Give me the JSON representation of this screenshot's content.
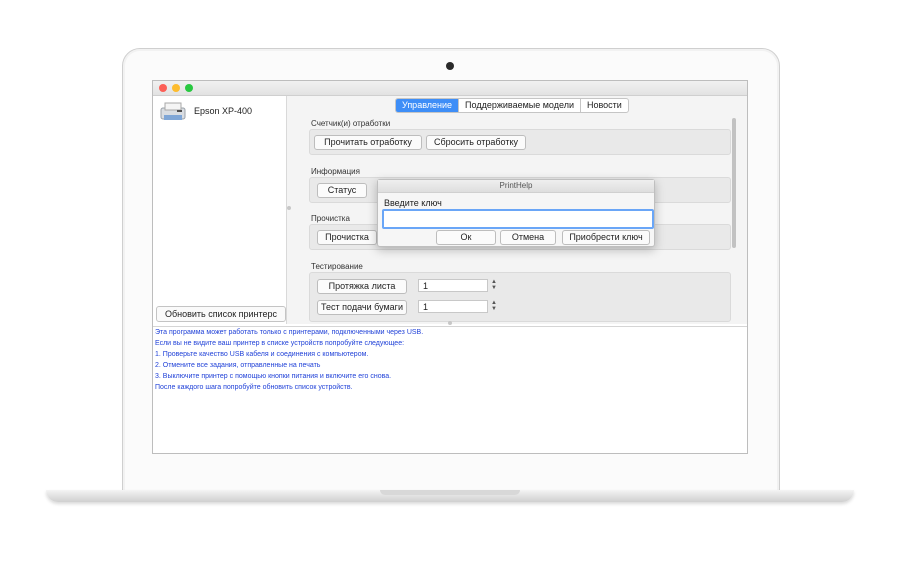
{
  "window": {
    "printer_name": "Epson XP-400",
    "refresh_button": "Обновить список принтерс"
  },
  "tabs": [
    {
      "label": "Управление",
      "active": true
    },
    {
      "label": "Поддерживаемые модели",
      "active": false
    },
    {
      "label": "Новости",
      "active": false
    }
  ],
  "counters": {
    "label": "Счетчик(и) отработки",
    "read_button": "Прочитать отработку",
    "reset_button": "Сбросить отработку"
  },
  "information": {
    "label": "Информация",
    "status_button": "Статус"
  },
  "cleaning": {
    "label": "Прочистка",
    "clean_button": "Прочистка"
  },
  "testing": {
    "label": "Тестирование",
    "rows": [
      {
        "button": "Протяжка листа",
        "value": "1"
      },
      {
        "button": "Тест подачи бумаги",
        "value": "1"
      }
    ]
  },
  "dialog": {
    "title": "PrintHelp",
    "prompt": "Введите ключ",
    "input_value": "",
    "ok_button": "Ок",
    "cancel_button": "Отмена",
    "buy_button": "Приобрести ключ"
  },
  "info_text": [
    "Эта программа может работать только с принтерами, подключенными через USB.",
    "Если вы не видите ваш принтер в списке устройств попробуйте следующее:",
    "1. Проверьте качество USB кабеля и соединения с компьютером.",
    "2. Отмените все задания, отправленные на печать",
    "3. Выключите принтер с помощью кнопки питания и включите его снова.",
    "После каждого шага попробуйте обновить список устройств."
  ],
  "colors": {
    "accent": "#3e8ef7",
    "info_text": "#2142d8"
  }
}
